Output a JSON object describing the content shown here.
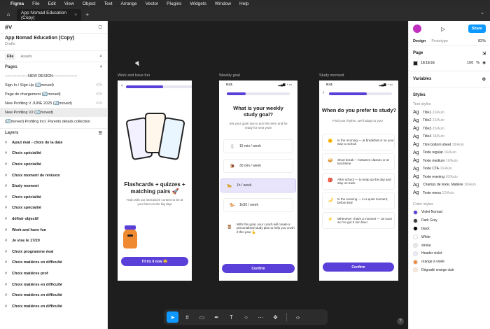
{
  "menubar": {
    "app": "Figma",
    "items": [
      "File",
      "Edit",
      "View",
      "Object",
      "Text",
      "Arrange",
      "Vector",
      "Plugins",
      "Widgets",
      "Window",
      "Help"
    ]
  },
  "tab": {
    "title": "App Nomad Education (Copy)"
  },
  "left": {
    "project_name": "App Nomad Education (Copy)",
    "project_location": "Drafts",
    "tab_file": "File",
    "tab_assets": "Assets",
    "pages_title": "Pages",
    "pages": [
      "------------------NEW DESIGN-------------------",
      "Sign In / Sign Up (🔄moved)",
      "Page de chargement (🔄moved)",
      "New Profiling V JUNE 2025 (🔄moved)",
      "New Profiling  V2 (🔄moved)",
      "(🔄moved) Profiling incl. Parents details collection"
    ],
    "layers_title": "Layers",
    "layers": [
      "Ajout éval - choix de la date",
      "Choix spécialité",
      "Choix spécialité",
      "Choix moment de révision",
      "Study moment",
      "Choix spécialité",
      "Choix spécialité",
      "définir objectif",
      "Work and have fun",
      "Je vise le 17/20",
      "Choix programme éval",
      "Choix matières en difficulté",
      "Choix matières prof",
      "Choix matières en difficulté",
      "Choix matières en difficulté",
      "Choix matières en difficulté"
    ]
  },
  "canvas": {
    "frame1": {
      "label": "Work and have fun",
      "title": "Flashcards + quizzes + matching pairs 🚀",
      "subtitle": "Train with our interactive content to be at your best on the big day!",
      "cta": "I'll try it now 😄",
      "progress": 0.55
    },
    "frame2": {
      "label": "Weekly goal",
      "time": "9:41",
      "title": "What is your weekly study goal?",
      "subtitle": "Set your goal now to ace this term and be ready for next year!",
      "options": [
        {
          "icon": "🐇",
          "text": "15 min / week"
        },
        {
          "icon": "🐌",
          "text": "30 min / week"
        },
        {
          "icon": "🐆",
          "text": "1h / week"
        },
        {
          "icon": "🐎",
          "text": "1h30 / week"
        }
      ],
      "coach_text": "With this goal, your coach will create a personalised study plan to help you crush it this year 💪",
      "cta": "Confirm",
      "progress": 0.3
    },
    "frame3": {
      "label": "Study moment",
      "time": "9:41",
      "title": "When do you prefer to study?",
      "subtitle": "Find your rhythm, we'll adapt to you!",
      "options": [
        {
          "icon": "🌞",
          "text": "In the morning — at breakfast or on your way to school"
        },
        {
          "icon": "🥪",
          "text": "Short break — between classes or at lunchtime"
        },
        {
          "icon": "🎒",
          "text": "After school — to wrap up the day and stay on track"
        },
        {
          "icon": "🌙",
          "text": "In the evening — in a quiet moment, before bed"
        },
        {
          "icon": "⚡",
          "text": "Whenever I have a moment — as soon as I've got 5 min free!"
        }
      ],
      "cta": "Confirm",
      "progress": 0.6
    }
  },
  "right": {
    "share": "Share",
    "tab_design": "Design",
    "tab_prototype": "Prototype",
    "zoom": "82%",
    "page_section": "Page",
    "page_color": "1E1E1E",
    "page_opacity": "100",
    "page_opacity_unit": "%",
    "variables": "Variables",
    "styles": "Styles",
    "text_styles_label": "Text styles",
    "text_styles": [
      {
        "name": "Title1",
        "size": "22/Auto"
      },
      {
        "name": "Title2",
        "size": "22/Auto"
      },
      {
        "name": "Title3",
        "size": "22/Auto"
      },
      {
        "name": "Title4",
        "size": "18/Auto"
      },
      {
        "name": "Titre bottom sheet",
        "size": "18/Auto"
      },
      {
        "name": "Texte regular",
        "size": "16/Auto"
      },
      {
        "name": "Texte medium",
        "size": "16/Auto"
      },
      {
        "name": "Texte CTA",
        "size": "16/Auto"
      },
      {
        "name": "Texte evening",
        "size": "16/Auto"
      },
      {
        "name": "Champs de texte, Matière",
        "size": "16/Auto"
      },
      {
        "name": "Texte menu",
        "size": "12/Auto"
      }
    ],
    "color_styles_label": "Color styles",
    "color_styles": [
      {
        "name": "Violet Nomad",
        "color": "#5b3fd9"
      },
      {
        "name": "Dark Grey",
        "color": "#3a3a3a"
      },
      {
        "name": "black",
        "color": "#000000"
      },
      {
        "name": "White",
        "color": "#ffffff"
      },
      {
        "name": "stroke",
        "color": "#e8e8e8"
      },
      {
        "name": "Header violet",
        "color": "#efeaff"
      },
      {
        "name": "orange à violet",
        "color": "#f28b3c"
      },
      {
        "name": "Dégradé orange clair",
        "color": "#fde7d3"
      }
    ]
  }
}
